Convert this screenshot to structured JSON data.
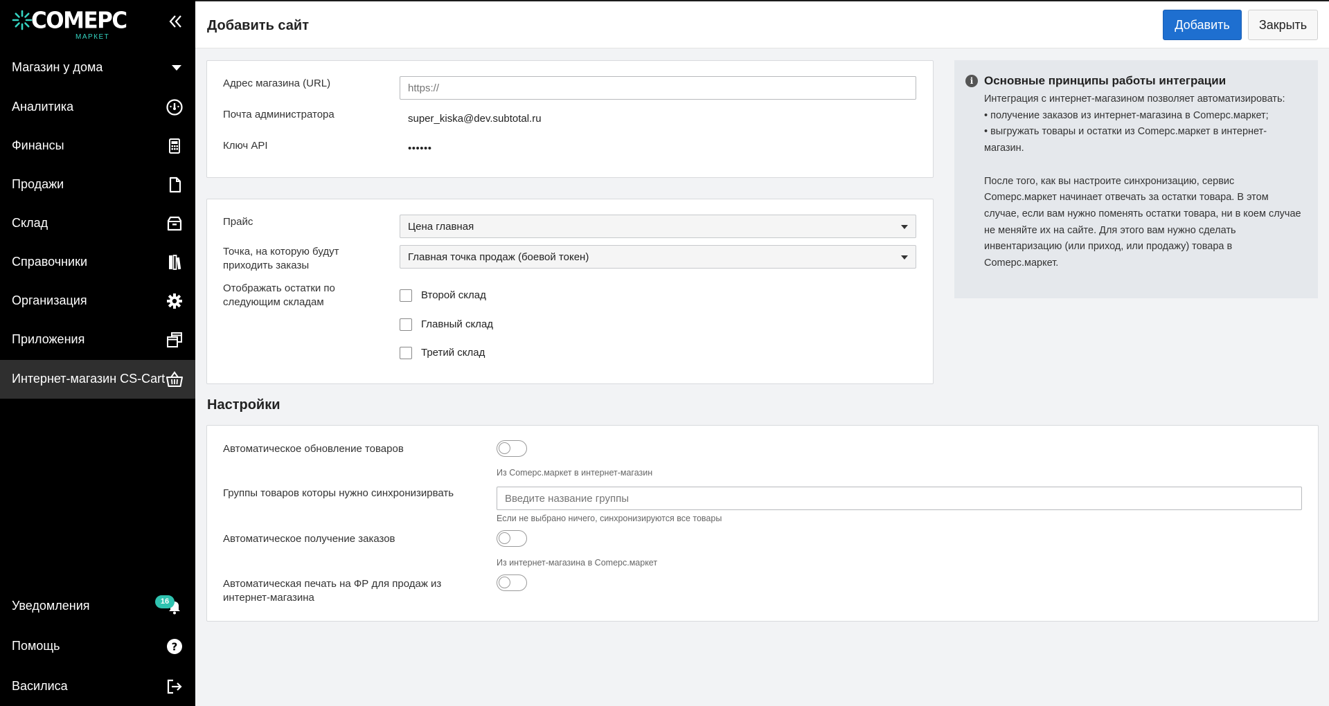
{
  "brand": {
    "name": "COMEPC",
    "sub": "МАРКЕТ",
    "accent": "#35d4c2"
  },
  "sidebar": {
    "shop_name": "Магазин у дома",
    "items": [
      {
        "label": "Аналитика",
        "icon": "gauge-icon"
      },
      {
        "label": "Финансы",
        "icon": "calculator-icon"
      },
      {
        "label": "Продажи",
        "icon": "document-icon"
      },
      {
        "label": "Склад",
        "icon": "box-icon"
      },
      {
        "label": "Справочники",
        "icon": "books-icon"
      },
      {
        "label": "Организация",
        "icon": "gear-icon"
      },
      {
        "label": "Приложения",
        "icon": "windows-icon"
      },
      {
        "label": "Интернет-магазин CS-Cart",
        "icon": "basket-icon",
        "active": true
      }
    ],
    "bottom": [
      {
        "label": "Уведомления",
        "icon": "bell-icon",
        "badge": "16"
      },
      {
        "label": "Помощь",
        "icon": "help-icon"
      },
      {
        "label": "Василиса",
        "icon": "logout-icon"
      }
    ]
  },
  "header": {
    "title": "Добавить сайт",
    "add_label": "Добавить",
    "close_label": "Закрыть"
  },
  "site_form": {
    "url_label": "Адрес магазина (URL)",
    "url_placeholder": "https://",
    "email_label": "Почта администратора",
    "email_value": "super_kiska@dev.subtotal.ru",
    "api_label": "Ключ API",
    "api_value": "••••••"
  },
  "price_form": {
    "price_label": "Прайс",
    "price_value": "Цена главная",
    "point_label": "Точка, на которую будут приходить заказы",
    "point_value": "Главная точка продаж (боевой токен)",
    "stock_label": "Отображать остатки по следующим складам",
    "warehouses": [
      "Второй склад",
      "Главный склад",
      "Третий склад"
    ]
  },
  "settings": {
    "title": "Настройки",
    "auto_update_label": "Автоматическое обновление товаров",
    "auto_update_hint": "Из Comepc.маркет в интернет-магазин",
    "groups_label": "Группы товаров которы нужно синхронизирвать",
    "groups_placeholder": "Введите название группы",
    "groups_hint": "Если не выбрано ничего, синхронизируются все товары",
    "auto_orders_label": "Автоматическое получение заказов",
    "auto_orders_hint": "Из интернет-магазина в Comepc.маркет",
    "auto_print_label": "Автоматическая печать на ФР для продаж из интернет-магазина"
  },
  "info": {
    "title": "Основные принципы работы интеграции",
    "p1": "Интеграция с интернет-магазином позволяет автоматизировать:",
    "b1": "• получение заказов из интернет-магазина в Comepc.маркет;",
    "b2": "• выгружать товары и остатки из Comepc.маркет в интернет-магазин.",
    "p2": "После того, как вы настроите синхронизацию, сервис Comepc.маркет начинает отвечать за остатки товара. В этом случае, если вам нужно поменять остатки товара, ни в коем случае не меняйте их на сайте. Для этого вам нужно сделать инвентаризацию (или приход, или продажу) товара в Comepc.маркет."
  }
}
